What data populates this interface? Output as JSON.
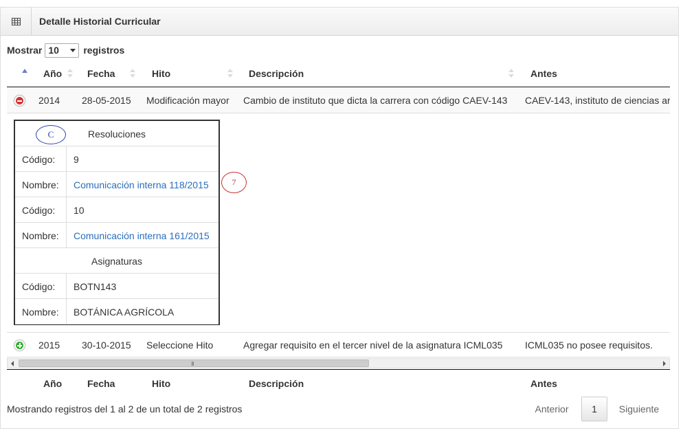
{
  "panel": {
    "title": "Detalle Historial Curricular",
    "icon": "table-grid-icon"
  },
  "length": {
    "prefix": "Mostrar",
    "value": "10",
    "suffix": "registros"
  },
  "columns": [
    "Año",
    "Fecha",
    "Hito",
    "Descripción",
    "Antes"
  ],
  "rows": [
    {
      "year": "2014",
      "date": "28-05-2015",
      "milestone": "Modificación mayor",
      "description": "Cambio de instituto que dicta la carrera con código CAEV-143",
      "before": "CAEV-143, instituto de ciencias ar",
      "expanded": true
    },
    {
      "year": "2015",
      "date": "30-10-2015",
      "milestone": "Seleccione Hito",
      "description": "Agregar requisito en el tercer nivel de la asignatura ICML035",
      "before": "ICML035 no posee requisitos.",
      "expanded": false
    }
  ],
  "detail": {
    "resoluciones_header": "Resoluciones",
    "asignaturas_header": "Asignaturas",
    "resoluciones": [
      {
        "code_label": "Código:",
        "code": "9",
        "name_label": "Nombre:",
        "name": "Comunicación interna 118/2015"
      },
      {
        "code_label": "Código:",
        "code": "10",
        "name_label": "Nombre:",
        "name": "Comunicación interna 161/2015"
      }
    ],
    "asignaturas": [
      {
        "code_label": "Código:",
        "code": "BOTN143",
        "name_label": "Nombre:",
        "name": "BOTÁNICA AGRÍCOLA"
      }
    ]
  },
  "annotations": {
    "mark_c": "C",
    "mark_7": "7"
  },
  "scroll": {
    "grip": "III"
  },
  "footer": {
    "info": "Mostrando registros del 1 al 2 de un total de 2 registros",
    "prev": "Anterior",
    "current_page": "1",
    "next": "Siguiente"
  },
  "colors": {
    "link": "#2a6ebb",
    "collapse_button": "#d33333",
    "expand_button": "#31b131",
    "sort_active": "#6d7fc7"
  }
}
